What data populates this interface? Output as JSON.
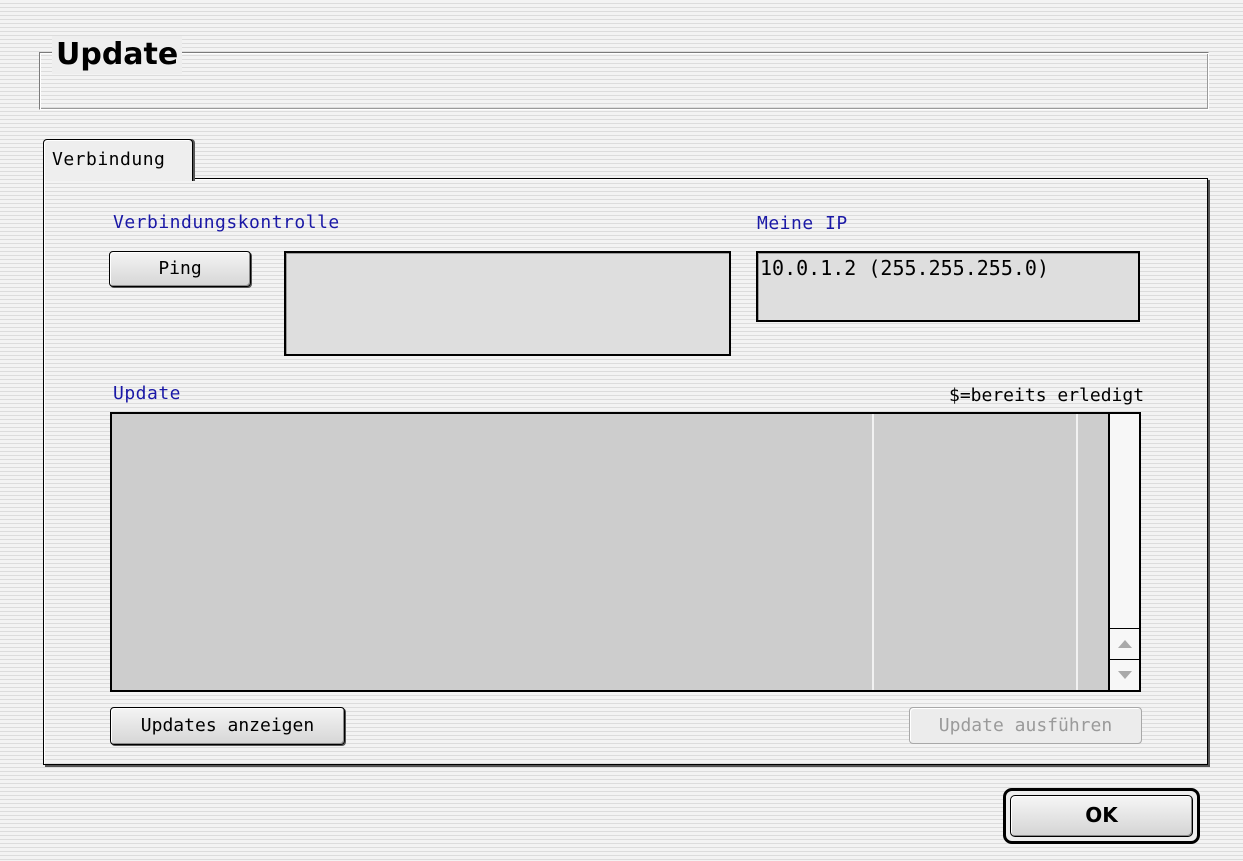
{
  "dialog": {
    "title": "Update"
  },
  "tabs": [
    {
      "label": "Verbindung",
      "active": true
    }
  ],
  "connection": {
    "section_label": "Verbindungskontrolle",
    "ping_label": "Ping",
    "ping_result": ""
  },
  "my_ip": {
    "section_label": "Meine IP",
    "value": "10.0.1.2 (255.255.255.0)"
  },
  "update": {
    "section_label": "Update",
    "legend": "$=bereits erledigt",
    "show_button": "Updates anzeigen",
    "run_button": "Update ausführen",
    "run_enabled": false,
    "items": []
  },
  "footer": {
    "ok_label": "OK"
  },
  "colors": {
    "label_blue": "#1a18a6",
    "field_bg": "#dedede",
    "list_bg": "#cdcdcd"
  }
}
